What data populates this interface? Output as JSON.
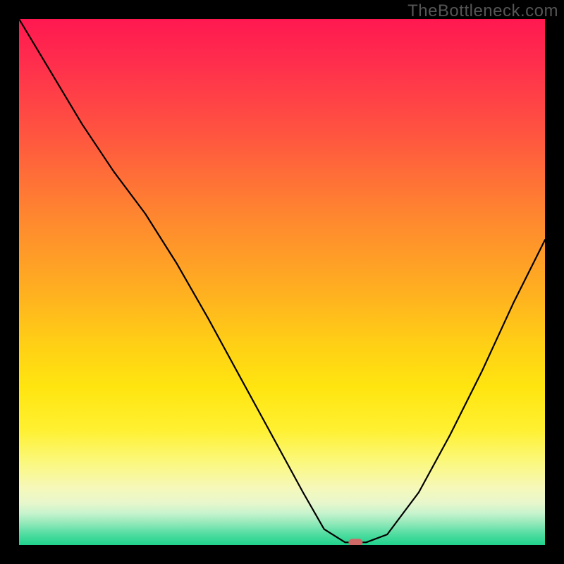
{
  "watermark": "TheBottleneck.com",
  "chart_data": {
    "type": "line",
    "title": "",
    "xlabel": "",
    "ylabel": "",
    "xlim": [
      0,
      100
    ],
    "ylim": [
      0,
      100
    ],
    "grid": false,
    "x": [
      0,
      6,
      12,
      18,
      24,
      30,
      36,
      42,
      48,
      54,
      58,
      62,
      66,
      70,
      76,
      82,
      88,
      94,
      100
    ],
    "values": [
      100,
      90,
      80,
      71,
      63,
      53.5,
      43,
      32,
      21,
      10,
      3,
      0.5,
      0.5,
      2,
      10,
      21,
      33,
      46,
      58
    ],
    "marker": {
      "x": 64,
      "y": 0.5
    },
    "background": "vertical heat gradient red-yellow-green"
  },
  "colors": {
    "frame": "#000000",
    "curve": "#000000",
    "marker": "#d06868",
    "watermark": "#555555"
  }
}
